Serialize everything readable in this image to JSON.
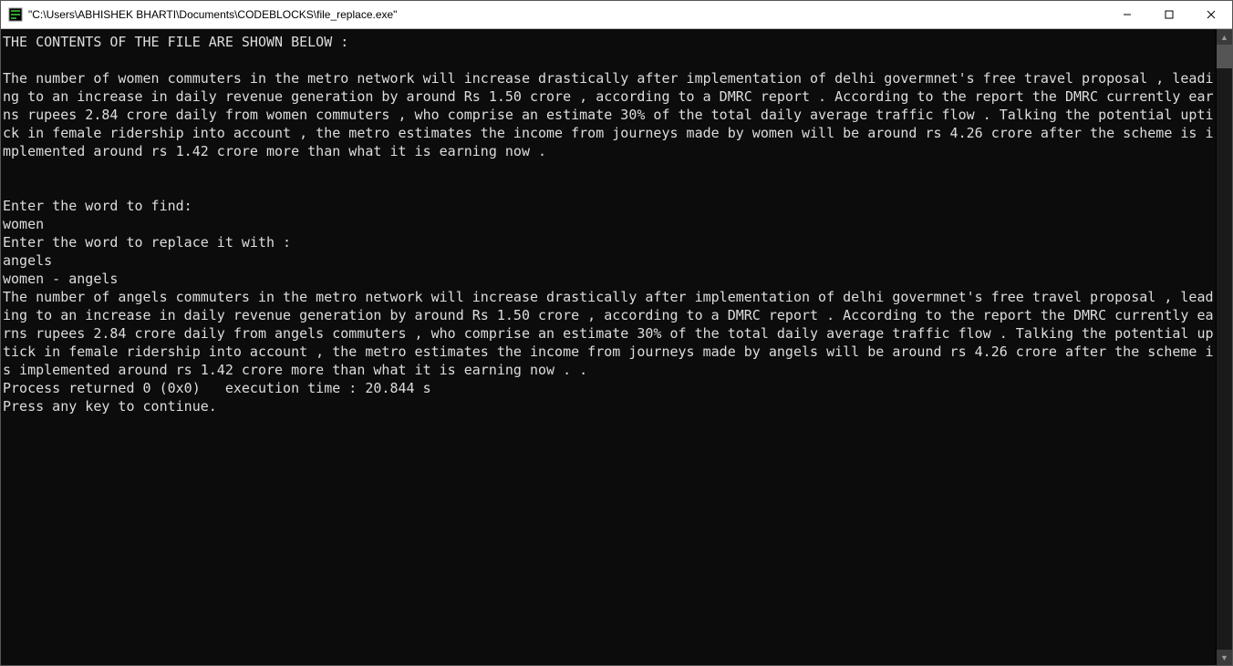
{
  "window": {
    "title": "\"C:\\Users\\ABHISHEK BHARTI\\Documents\\CODEBLOCKS\\file_replace.exe\""
  },
  "controls": {
    "minimize_glyph": "—",
    "maximize_glyph": "□",
    "close_glyph": "✕"
  },
  "console": {
    "lines": [
      "THE CONTENTS OF THE FILE ARE SHOWN BELOW :",
      "",
      "The number of women commuters in the metro network will increase drastically after implementation of delhi govermnet's free travel proposal , leading to an increase in daily revenue generation by around Rs 1.50 crore , according to a DMRC report . According to the report the DMRC currently earns rupees 2.84 crore daily from women commuters , who comprise an estimate 30% of the total daily average traffic flow . Talking the potential uptick in female ridership into account , the metro estimates the income from journeys made by women will be around rs 4.26 crore after the scheme is implemented around rs 1.42 crore more than what it is earning now .",
      "",
      "",
      "Enter the word to find:",
      "women",
      "Enter the word to replace it with :",
      "angels",
      "women - angels",
      "The number of angels commuters in the metro network will increase drastically after implementation of delhi govermnet's free travel proposal , leading to an increase in daily revenue generation by around Rs 1.50 crore , according to a DMRC report . According to the report the DMRC currently earns rupees 2.84 crore daily from angels commuters , who comprise an estimate 30% of the total daily average traffic flow . Talking the potential uptick in female ridership into account , the metro estimates the income from journeys made by angels will be around rs 4.26 crore after the scheme is implemented around rs 1.42 crore more than what it is earning now . .",
      "Process returned 0 (0x0)   execution time : 20.844 s",
      "Press any key to continue."
    ]
  },
  "scrollbar": {
    "up_glyph": "▲",
    "down_glyph": "▼"
  }
}
